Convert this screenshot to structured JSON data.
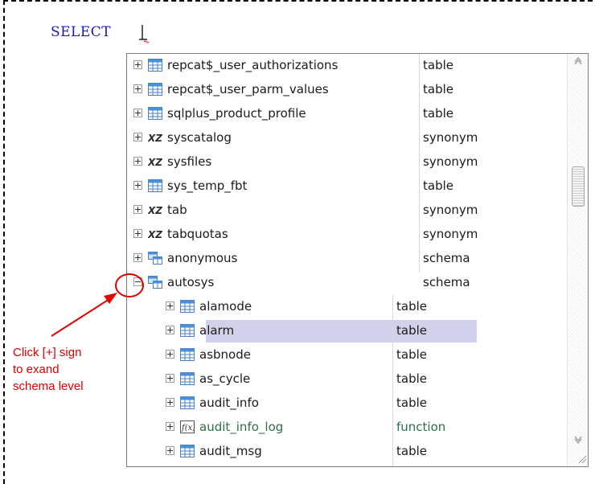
{
  "editor": {
    "keyword": "SELECT"
  },
  "items": [
    {
      "name": "repcat$_user_authorizations",
      "type": "table",
      "kind": "table",
      "expander": "plus"
    },
    {
      "name": "repcat$_user_parm_values",
      "type": "table",
      "kind": "table",
      "expander": "plus"
    },
    {
      "name": "sqlplus_product_profile",
      "type": "table",
      "kind": "table",
      "expander": "plus"
    },
    {
      "name": "syscatalog",
      "type": "synonym",
      "kind": "synonym",
      "expander": "plus"
    },
    {
      "name": "sysfiles",
      "type": "synonym",
      "kind": "synonym",
      "expander": "plus"
    },
    {
      "name": "sys_temp_fbt",
      "type": "table",
      "kind": "table",
      "expander": "plus"
    },
    {
      "name": "tab",
      "type": "synonym",
      "kind": "synonym",
      "expander": "plus"
    },
    {
      "name": "tabquotas",
      "type": "synonym",
      "kind": "synonym",
      "expander": "plus"
    },
    {
      "name": "anonymous",
      "type": "schema",
      "kind": "schema",
      "expander": "plus"
    },
    {
      "name": "autosys",
      "type": "schema",
      "kind": "schema",
      "expander": "minus"
    }
  ],
  "children": [
    {
      "name": "alamode",
      "type": "table",
      "kind": "table",
      "selected": false
    },
    {
      "name": "alarm",
      "type": "table",
      "kind": "table",
      "selected": true
    },
    {
      "name": "asbnode",
      "type": "table",
      "kind": "table",
      "selected": false
    },
    {
      "name": "as_cycle",
      "type": "table",
      "kind": "table",
      "selected": false
    },
    {
      "name": "audit_info",
      "type": "table",
      "kind": "table",
      "selected": false
    },
    {
      "name": "audit_info_log",
      "type": "function",
      "kind": "function",
      "selected": false
    },
    {
      "name": "audit_msg",
      "type": "table",
      "kind": "table",
      "selected": false
    }
  ],
  "annotation": {
    "lines": [
      "Click [+] sign",
      "to exand",
      "schema level"
    ],
    "color": "#e00000"
  },
  "colors": {
    "selection": "#d1d1ec",
    "function_text": "#2d6e4a",
    "keyword": "#1a1ab4"
  },
  "icons": {
    "table": "table-icon",
    "synonym": "synonym-icon",
    "schema": "schema-icon",
    "function": "function-icon"
  }
}
